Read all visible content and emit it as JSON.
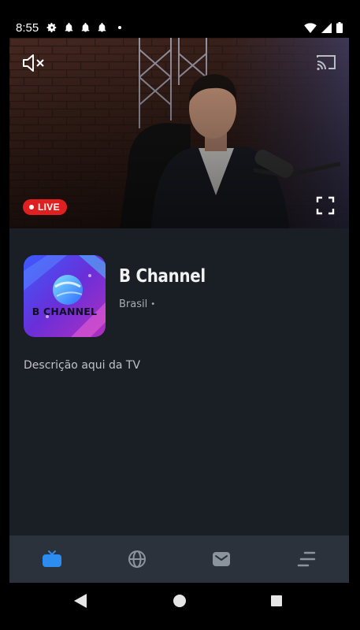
{
  "status_bar": {
    "time": "8:55",
    "left_icons": [
      "gear-icon",
      "bell-icon",
      "bell-icon",
      "bell-icon",
      "dot-icon"
    ],
    "right_icons": [
      "wifi-icon",
      "signal-icon",
      "battery-icon"
    ]
  },
  "player": {
    "live_label": "LIVE",
    "controls": [
      "mute-icon",
      "cast-icon",
      "fullscreen-icon"
    ],
    "accent_live": "#e02020"
  },
  "channel": {
    "logo_text": "B CHANNEL",
    "name": "B Channel",
    "country": "Brasil",
    "separator": "•",
    "description": "Descrição aqui da TV"
  },
  "bottom_nav": {
    "items": [
      "tv-icon",
      "globe-icon",
      "mail-icon",
      "menu-icon"
    ],
    "active_index": 0,
    "active_color": "#2d8cf0"
  },
  "system_nav": [
    "back-icon",
    "home-icon",
    "recents-icon"
  ]
}
